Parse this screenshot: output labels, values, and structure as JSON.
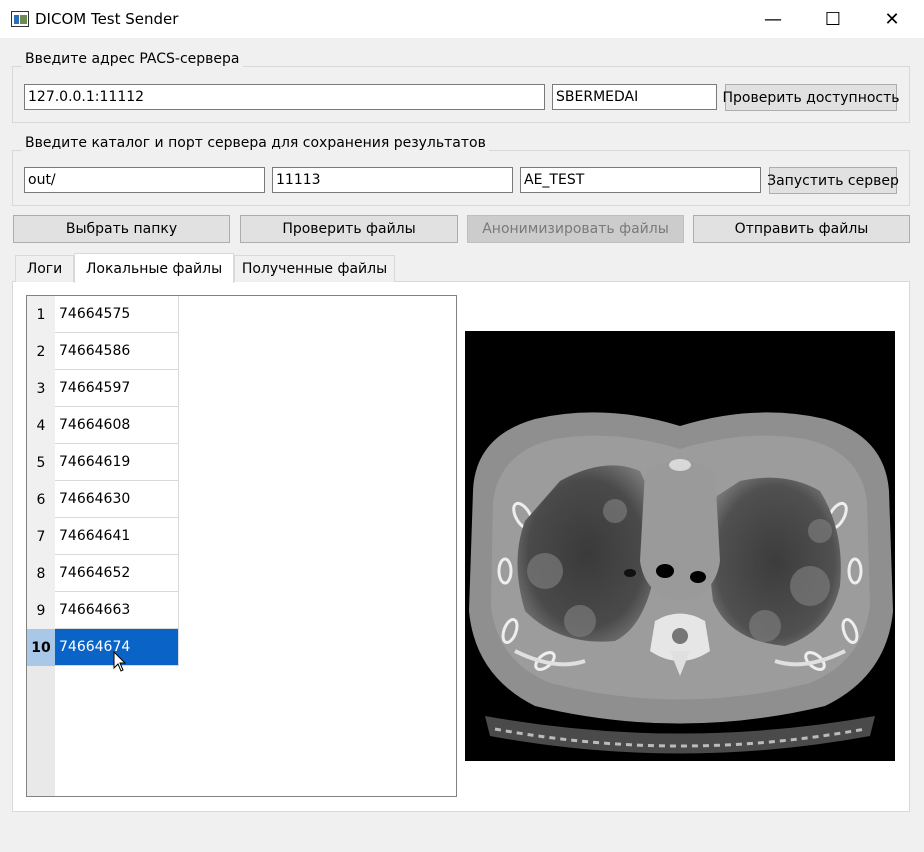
{
  "window": {
    "title": "DICOM Test Sender",
    "controls": [
      "minimize",
      "maximize",
      "close"
    ]
  },
  "pacs_group": {
    "label": "Введите адрес PACS-сервера",
    "address_value": "127.0.0.1:11112",
    "aet_value": "SBERMEDAI",
    "check_button": "Проверить доступность"
  },
  "server_group": {
    "label": "Введите каталог и порт сервера для сохранения результатов",
    "dir_value": "out/",
    "port_value": "11113",
    "aet_value": "AE_TEST",
    "start_button": "Запустить сервер"
  },
  "actions": {
    "select_folder": "Выбрать папку",
    "check_files": "Проверить файлы",
    "anonymize_files": "Анонимизировать файлы",
    "send_files": "Отправить файлы"
  },
  "tabs": [
    {
      "label": "Логи",
      "active": false
    },
    {
      "label": "Локальные файлы",
      "active": true
    },
    {
      "label": "Полученные файлы",
      "active": false
    }
  ],
  "file_table": {
    "rows": [
      {
        "index": "1",
        "value": "74664575"
      },
      {
        "index": "2",
        "value": "74664586"
      },
      {
        "index": "3",
        "value": "74664597"
      },
      {
        "index": "4",
        "value": "74664608"
      },
      {
        "index": "5",
        "value": "74664619"
      },
      {
        "index": "6",
        "value": "74664630"
      },
      {
        "index": "7",
        "value": "74664641"
      },
      {
        "index": "8",
        "value": "74664652"
      },
      {
        "index": "9",
        "value": "74664663"
      },
      {
        "index": "10",
        "value": "74664674"
      }
    ],
    "selected_row": "10"
  },
  "preview": {
    "kind": "CT axial chest slice (grayscale)"
  },
  "colors": {
    "selection": "#0a64c8",
    "window_bg": "#f0f0f0",
    "button_bg": "#e1e1e1"
  }
}
